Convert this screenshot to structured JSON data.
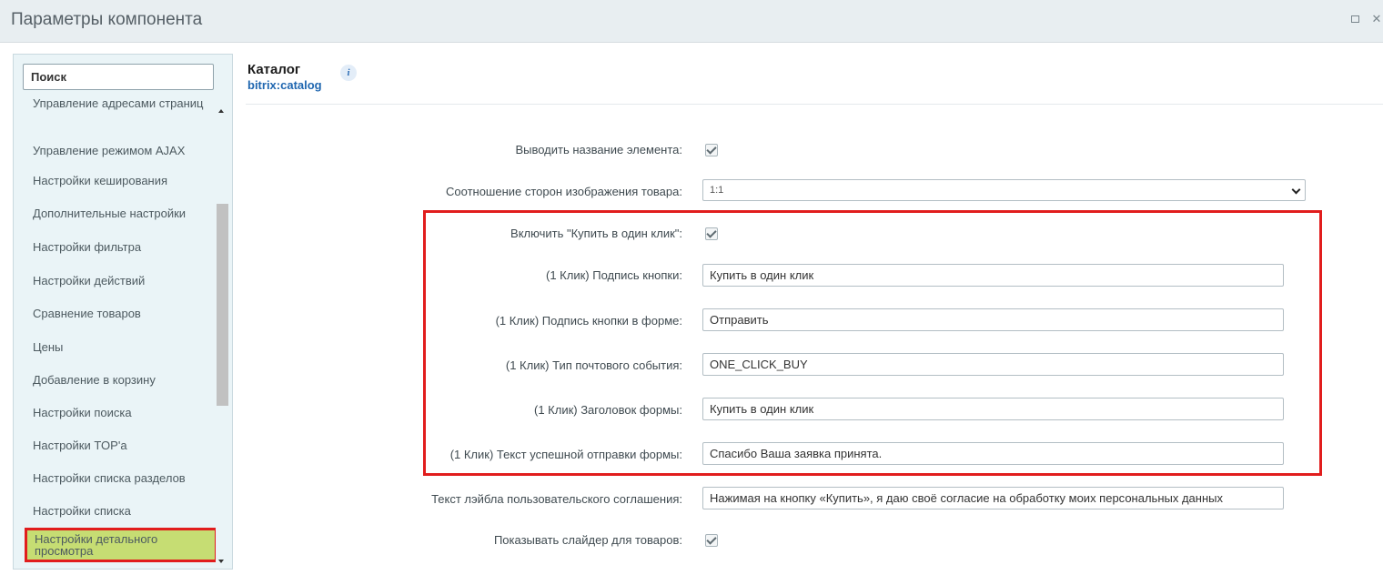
{
  "window": {
    "title": "Параметры компонента"
  },
  "sidebar": {
    "search_placeholder": "Поиск",
    "items": [
      {
        "label": "Управление адресами страниц"
      },
      {
        "label": "Управление режимом AJAX"
      },
      {
        "label": "Настройки кеширования"
      },
      {
        "label": "Дополнительные настройки"
      },
      {
        "label": "Настройки фильтра"
      },
      {
        "label": "Настройки действий"
      },
      {
        "label": "Сравнение товаров"
      },
      {
        "label": "Цены"
      },
      {
        "label": "Добавление в корзину"
      },
      {
        "label": "Настройки поиска"
      },
      {
        "label": "Настройки TOP'а"
      },
      {
        "label": "Настройки списка разделов"
      },
      {
        "label": "Настройки списка"
      },
      {
        "label": "Настройки детального просмотра",
        "selected": true
      }
    ]
  },
  "component": {
    "name": "Каталог",
    "code": "bitrix:catalog",
    "info_glyph": "i"
  },
  "params": {
    "show_name": {
      "label": "Выводить название элемента:",
      "checked": true
    },
    "aspect": {
      "label": "Соотношение сторон изображения товара:",
      "value": "1:1"
    },
    "one_click_enable": {
      "label": "Включить \"Купить в один клик\":",
      "checked": true
    },
    "button_caption": {
      "label": "(1 Клик) Подпись кнопки:",
      "value": "Купить в один клик"
    },
    "form_button_caption": {
      "label": "(1 Клик) Подпись кнопки в форме:",
      "value": "Отправить"
    },
    "mail_event": {
      "label": "(1 Клик) Тип почтового события:",
      "value": "ONE_CLICK_BUY"
    },
    "form_title": {
      "label": "(1 Клик) Заголовок формы:",
      "value": "Купить в один клик"
    },
    "success_text": {
      "label": "(1 Клик) Текст успешной отправки формы:",
      "value": "Спасибо Ваша заявка принята."
    },
    "agreement_label": {
      "label": "Текст лэйбла пользовательского соглашения:",
      "value": "Нажимая на кнопку «Купить», я даю своё согласие на обработку моих персональных данных"
    },
    "show_slider": {
      "label": "Показывать слайдер для товаров:",
      "checked": true
    }
  },
  "colors": {
    "highlight": "#e11d1d",
    "selected_item_bg": "#c6dd73",
    "link_blue": "#2067b0"
  }
}
